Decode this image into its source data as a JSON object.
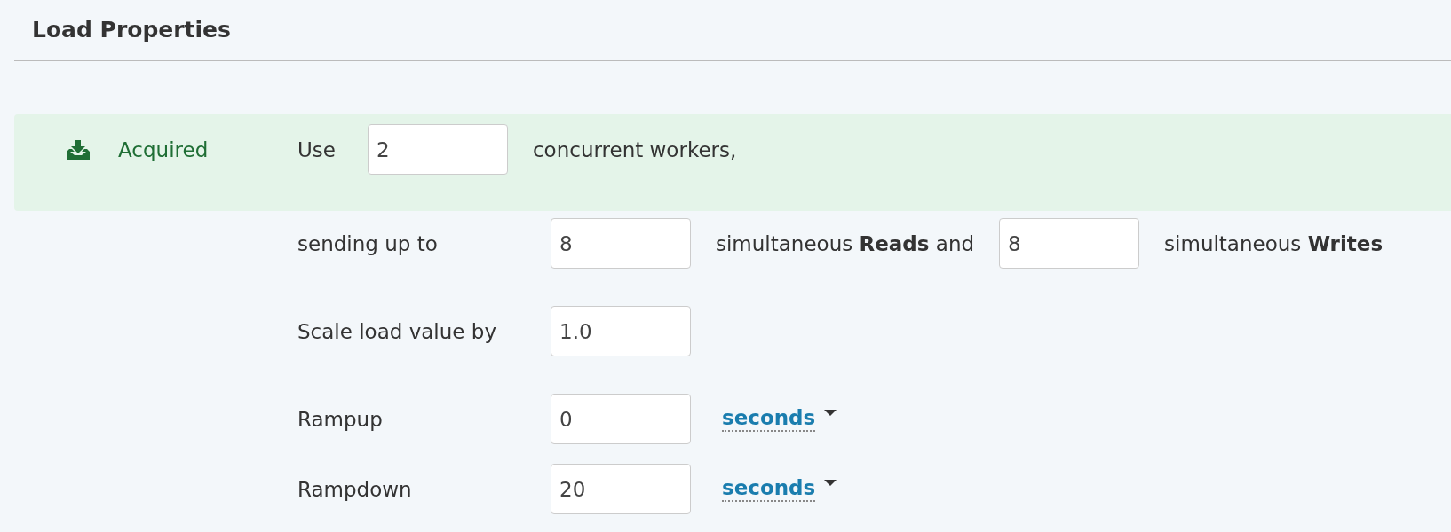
{
  "title": "Load Properties",
  "rows": [
    {
      "highlighted": true,
      "status": "Acquired",
      "segments": [
        {
          "kind": "text",
          "text": "Use"
        },
        {
          "kind": "field",
          "value": "2"
        },
        {
          "kind": "text",
          "text": "concurrent workers,"
        }
      ]
    },
    {
      "highlighted": false,
      "segments": [
        {
          "kind": "label",
          "text": "sending up to"
        },
        {
          "kind": "field",
          "value": "8"
        },
        {
          "kind": "text",
          "text": "simultaneous **Reads** and"
        },
        {
          "kind": "field",
          "value": "8"
        },
        {
          "kind": "text",
          "text": "simultaneous **Writes**"
        }
      ]
    },
    {
      "highlighted": false,
      "segments": [
        {
          "kind": "label",
          "text": "Scale load value by"
        },
        {
          "kind": "field",
          "value": "1.0"
        }
      ]
    },
    {
      "highlighted": false,
      "segments": [
        {
          "kind": "label",
          "text": "Rampup"
        },
        {
          "kind": "field",
          "value": "0"
        },
        {
          "kind": "dropdown",
          "text": "seconds"
        }
      ]
    },
    {
      "highlighted": false,
      "segments": [
        {
          "kind": "label",
          "text": "Rampdown"
        },
        {
          "kind": "field",
          "value": "20"
        },
        {
          "kind": "dropdown",
          "text": "seconds"
        }
      ]
    }
  ]
}
